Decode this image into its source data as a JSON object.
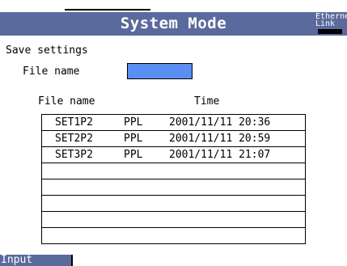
{
  "header": {
    "title": "System Mode",
    "ethernet_line1": "Ethernet",
    "ethernet_line2": "Link"
  },
  "save_settings": {
    "section_label": "Save settings",
    "file_name_label": "File name",
    "file_name_value": ""
  },
  "file_list": {
    "columns": {
      "file_name": "File name",
      "time": "Time"
    },
    "rows": [
      {
        "name": "SET1P2",
        "type": "PPL",
        "time": "2001/11/11 20:36"
      },
      {
        "name": "SET2P2",
        "type": "PPL",
        "time": "2001/11/11 20:59"
      },
      {
        "name": "SET3P2",
        "type": "PPL",
        "time": "2001/11/11 21:07"
      },
      {
        "name": "",
        "type": "",
        "time": ""
      },
      {
        "name": "",
        "type": "",
        "time": ""
      },
      {
        "name": "",
        "type": "",
        "time": ""
      },
      {
        "name": "",
        "type": "",
        "time": ""
      },
      {
        "name": "",
        "type": "",
        "time": ""
      }
    ]
  },
  "softkeys": {
    "input_label": "Input"
  },
  "colors": {
    "title_bar": "#5a6a9c",
    "input_field": "#5b8ef3",
    "softkey": "#5a6a9c"
  }
}
